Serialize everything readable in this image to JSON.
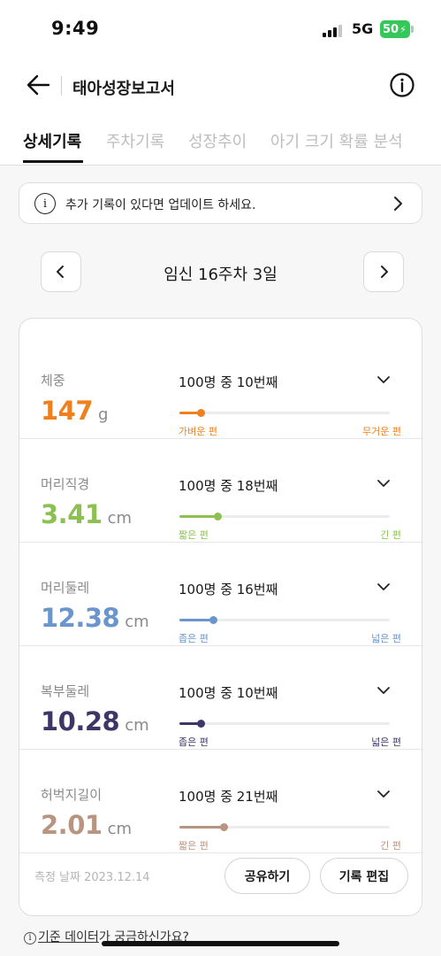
{
  "status_bar": {
    "time": "9:49",
    "network": "5G",
    "battery": "50"
  },
  "header": {
    "title": "태아성장보고서"
  },
  "tabs": [
    {
      "label": "상세기록",
      "active": true
    },
    {
      "label": "주차기록",
      "active": false
    },
    {
      "label": "성장추이",
      "active": false
    },
    {
      "label": "아기 크기 확률 분석",
      "active": false
    }
  ],
  "notice": {
    "icon": "i",
    "text": "추가 기록이 있다면 업데이트 하세요."
  },
  "week": {
    "label": "임신 16주차 3일"
  },
  "metrics": [
    {
      "label": "체중",
      "value": "147",
      "unit": "g",
      "rank": "100명 중 10번째",
      "min_label": "가벼운 편",
      "max_label": "무거운 편",
      "color": "#f07f1e",
      "level_percent": 10
    },
    {
      "label": "머리직경",
      "value": "3.41",
      "unit": "cm",
      "rank": "100명 중 18번째",
      "min_label": "짧은 편",
      "max_label": "긴 편",
      "color": "#8cc152",
      "level_percent": 18
    },
    {
      "label": "머리둘레",
      "value": "12.38",
      "unit": "cm",
      "rank": "100명 중 16번째",
      "min_label": "좁은 편",
      "max_label": "넓은 편",
      "color": "#6b95cd",
      "level_percent": 16
    },
    {
      "label": "복부둘레",
      "value": "10.28",
      "unit": "cm",
      "rank": "100명 중 10번째",
      "min_label": "좁은 편",
      "max_label": "넓은 편",
      "color": "#3d3768",
      "level_percent": 10
    },
    {
      "label": "허벅지길이",
      "value": "2.01",
      "unit": "cm",
      "rank": "100명 중 21번째",
      "min_label": "짧은 편",
      "max_label": "긴 편",
      "color": "#b89580",
      "level_percent": 21
    }
  ],
  "footer": {
    "measure_date": "측정 날짜 2023.12.14",
    "share_label": "공유하기",
    "edit_label": "기록 편집"
  },
  "bottom_link": {
    "icon": "i",
    "link_text": "기준 데이터",
    "suffix": "가 궁금하신가요?"
  }
}
